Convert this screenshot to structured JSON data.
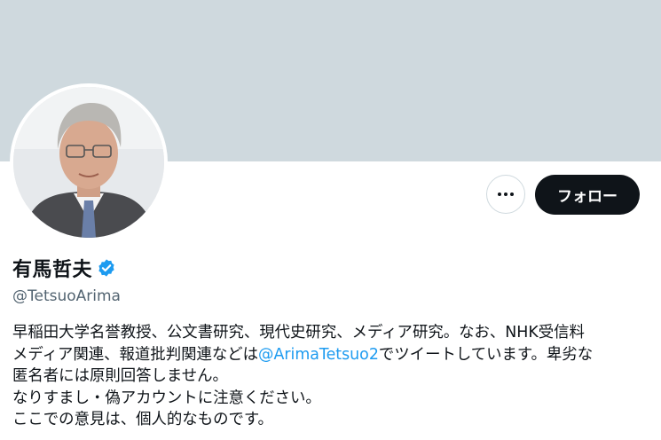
{
  "profile": {
    "display_name": "有馬哲夫",
    "handle": "@TetsuoArima",
    "follow_label": "フォロー",
    "more_icon": "more-horizontal-icon",
    "verified_icon": "verified-badge-icon",
    "verified_color": "#1d9bf0",
    "banner_color": "#cfd9de",
    "bio": {
      "line1": "早稲田大学名誉教授、公文書研究、現代史研究、メディア研究。なお、NHK受信料",
      "line2_pre": "メディア関連、報道批判関連などは",
      "line2_mention": "@ArimaTetsuo2",
      "line2_post": "でツイートしています。卑劣な",
      "line3": "匿名者には原則回答しません。",
      "line4": "なりすまし・偽アカウントに注意ください。",
      "line5": "ここでの意見は、個人的なものです。"
    }
  }
}
